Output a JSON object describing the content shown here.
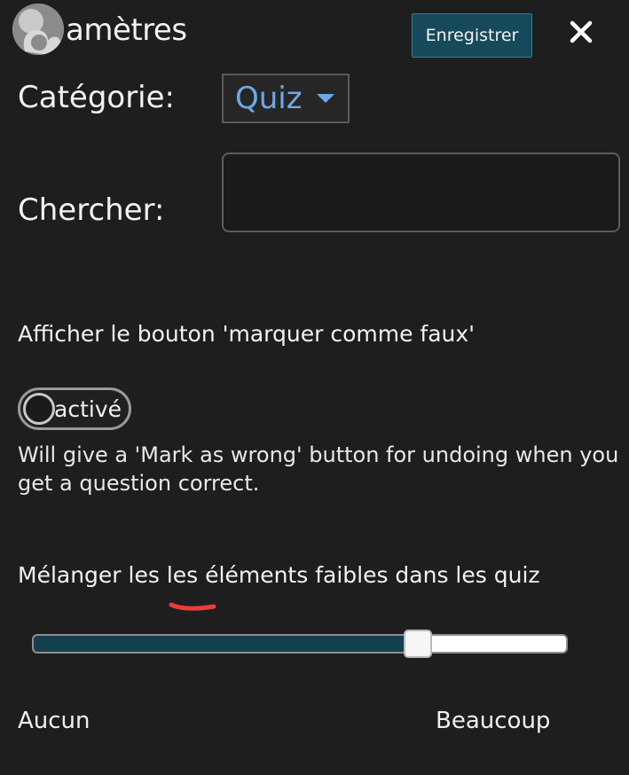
{
  "header": {
    "title": "amètres",
    "save_label": "Enregistrer",
    "close_icon": "close-icon",
    "avatar_icon": "profile-avatar"
  },
  "category": {
    "label": "Catégorie:",
    "selected": "Quiz"
  },
  "search": {
    "label": "Chercher:",
    "value": "",
    "placeholder": ""
  },
  "mark_wrong": {
    "title": "Afficher le bouton 'marquer comme faux'",
    "toggle_label": "sactivé",
    "toggle_on": false,
    "description": "Will give a 'Mark as wrong' button for undoing when you get a question correct."
  },
  "weak_items": {
    "title": "Mélanger les les éléments faibles dans les quiz",
    "slider_value": 0.72,
    "min_label": "Aucun",
    "max_label": "Beaucoup"
  },
  "colors": {
    "background": "#1e1e1e",
    "accent": "#164a5a",
    "select_text": "#6fa8e8",
    "annotation": "#ee3b3b"
  }
}
